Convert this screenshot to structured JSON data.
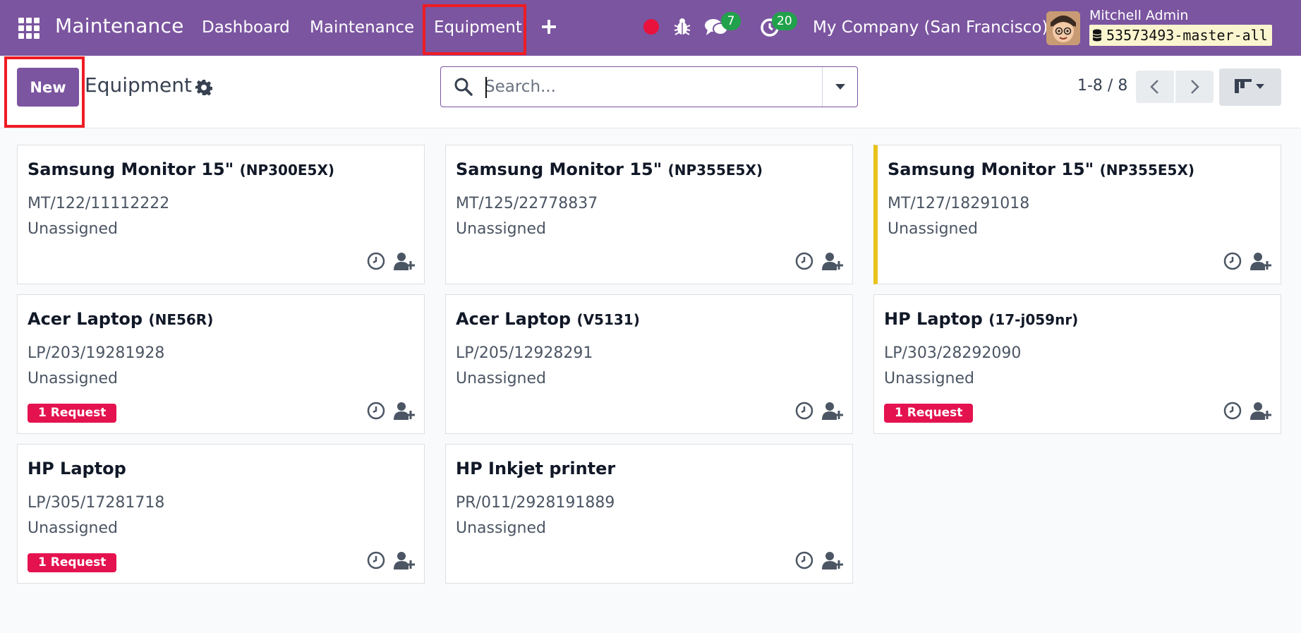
{
  "navbar": {
    "brand": "Maintenance",
    "menu": [
      "Dashboard",
      "Maintenance",
      "Equipment"
    ],
    "messages_count": "7",
    "activities_count": "20",
    "company": "My Company (San Francisco)",
    "user_name": "Mitchell Admin",
    "database": "53573493-master-all"
  },
  "control": {
    "new_label": "New",
    "title": "Equipment",
    "search_placeholder": "Search...",
    "pager": "1-8 / 8"
  },
  "cards": [
    {
      "name": "Samsung Monitor 15\"",
      "model": "(NP300E5X)",
      "serial": "MT/122/11112222",
      "owner": "Unassigned",
      "badge": ""
    },
    {
      "name": "Samsung Monitor 15\"",
      "model": "(NP355E5X)",
      "serial": "MT/125/22778837",
      "owner": "Unassigned",
      "badge": ""
    },
    {
      "name": "Samsung Monitor 15\"",
      "model": "(NP355E5X)",
      "serial": "MT/127/18291018",
      "owner": "Unassigned",
      "badge": ""
    },
    {
      "name": "Acer Laptop",
      "model": "(NE56R)",
      "serial": "LP/203/19281928",
      "owner": "Unassigned",
      "badge": "1 Request"
    },
    {
      "name": "Acer Laptop",
      "model": "(V5131)",
      "serial": "LP/205/12928291",
      "owner": "Unassigned",
      "badge": ""
    },
    {
      "name": "HP Laptop",
      "model": "(17-j059nr)",
      "serial": "LP/303/28292090",
      "owner": "Unassigned",
      "badge": "1 Request"
    },
    {
      "name": "HP Laptop",
      "model": "",
      "serial": "LP/305/17281718",
      "owner": "Unassigned",
      "badge": "1 Request"
    },
    {
      "name": "HP Inkjet printer",
      "model": "",
      "serial": "PR/011/2928191889",
      "owner": "Unassigned",
      "badge": ""
    }
  ],
  "colors": {
    "brand": "#7b55a0",
    "highlight_box": "#ef1c24",
    "request_badge": "#e4134f",
    "count_badge": "#21a14b",
    "flag": "#e9c21a"
  }
}
